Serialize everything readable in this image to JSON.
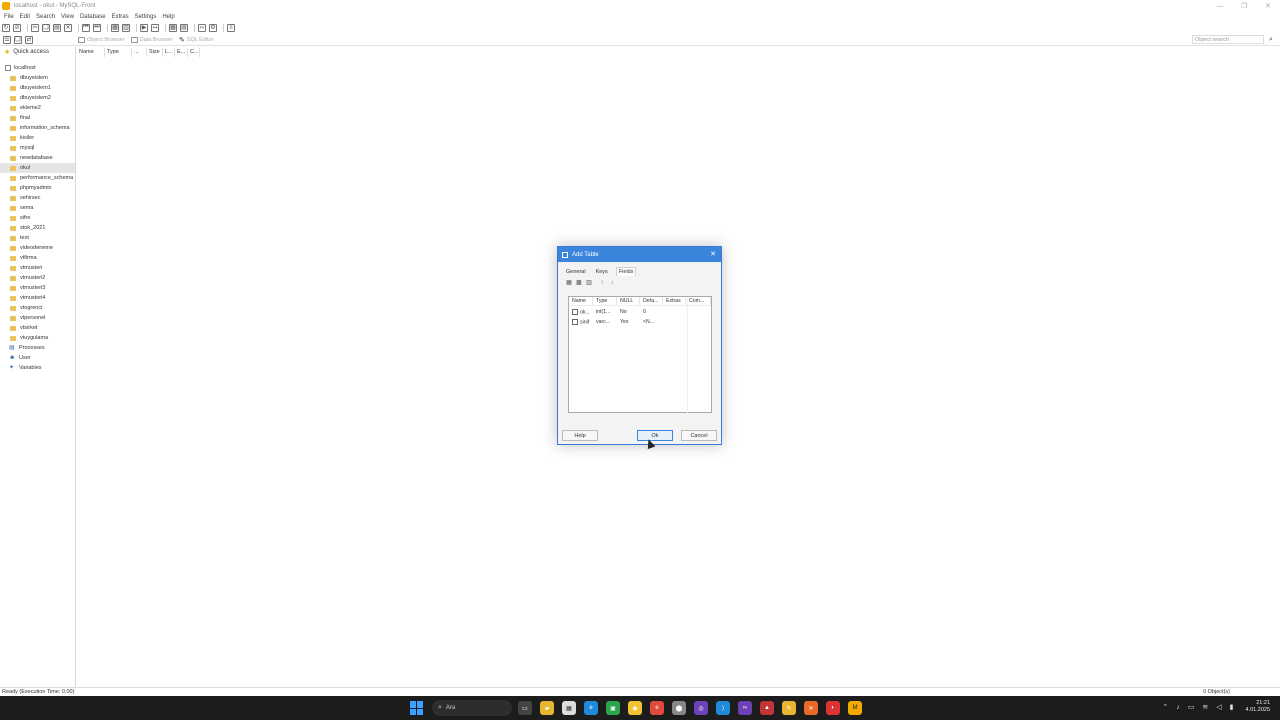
{
  "window": {
    "title": "localhost - okul - MySQL-Front"
  },
  "menu": [
    "File",
    "Edit",
    "Search",
    "View",
    "Database",
    "Extras",
    "Settings",
    "Help"
  ],
  "views": {
    "object_browser": "Object Browser",
    "data_browser": "Data Browser",
    "sql_editor": "SQL Editor"
  },
  "search": {
    "placeholder": "Object search"
  },
  "sidebar": {
    "quick_access": "Quick access",
    "host": "localhost",
    "databases": [
      "dbuyeislem",
      "dbuyeislem1",
      "dbuyeislem2",
      "ekleme2",
      "final",
      "information_schema",
      "kisiler",
      "mysql",
      "newdatabase",
      "okul",
      "performance_schema",
      "phpmyadmin",
      "sehirsec",
      "sema",
      "sifre",
      "stok_2021",
      "test",
      "videodeneme",
      "vtfirma",
      "vtmusteri",
      "vtmusteri2",
      "vtmusteri3",
      "vtmusteri4",
      "vtogrenci",
      "vtpersonel",
      "vtsirket",
      "vtuygulama"
    ],
    "selected": "okul",
    "misc": [
      "Processes",
      "User",
      "Variables"
    ]
  },
  "main": {
    "columns": [
      "Name",
      "Type",
      "...",
      "Size",
      "L...",
      "E...",
      "C..."
    ]
  },
  "status": {
    "left": "Ready  (Execution Time: 0.00)",
    "right": "0 Object(s)"
  },
  "dialog": {
    "title": "Add Table",
    "tabs": [
      "General",
      "Keys",
      "Fields"
    ],
    "active_tab": "Fields",
    "field_columns": [
      "Name",
      "Type",
      "NULL",
      "Defa...",
      "Extras",
      "Com..."
    ],
    "fields": [
      {
        "name": "ok...",
        "type": "int(1...",
        "null": "No",
        "default": "0",
        "extras": "",
        "comment": ""
      },
      {
        "name": "sinif",
        "type": "varc...",
        "null": "Yes",
        "default": "<N...",
        "extras": "",
        "comment": ""
      }
    ],
    "buttons": {
      "help": "Help",
      "ok": "Ok",
      "cancel": "Cancel"
    }
  },
  "taskbar": {
    "search_label": "Ara",
    "time": "21:21",
    "date": "4.01.2025"
  }
}
